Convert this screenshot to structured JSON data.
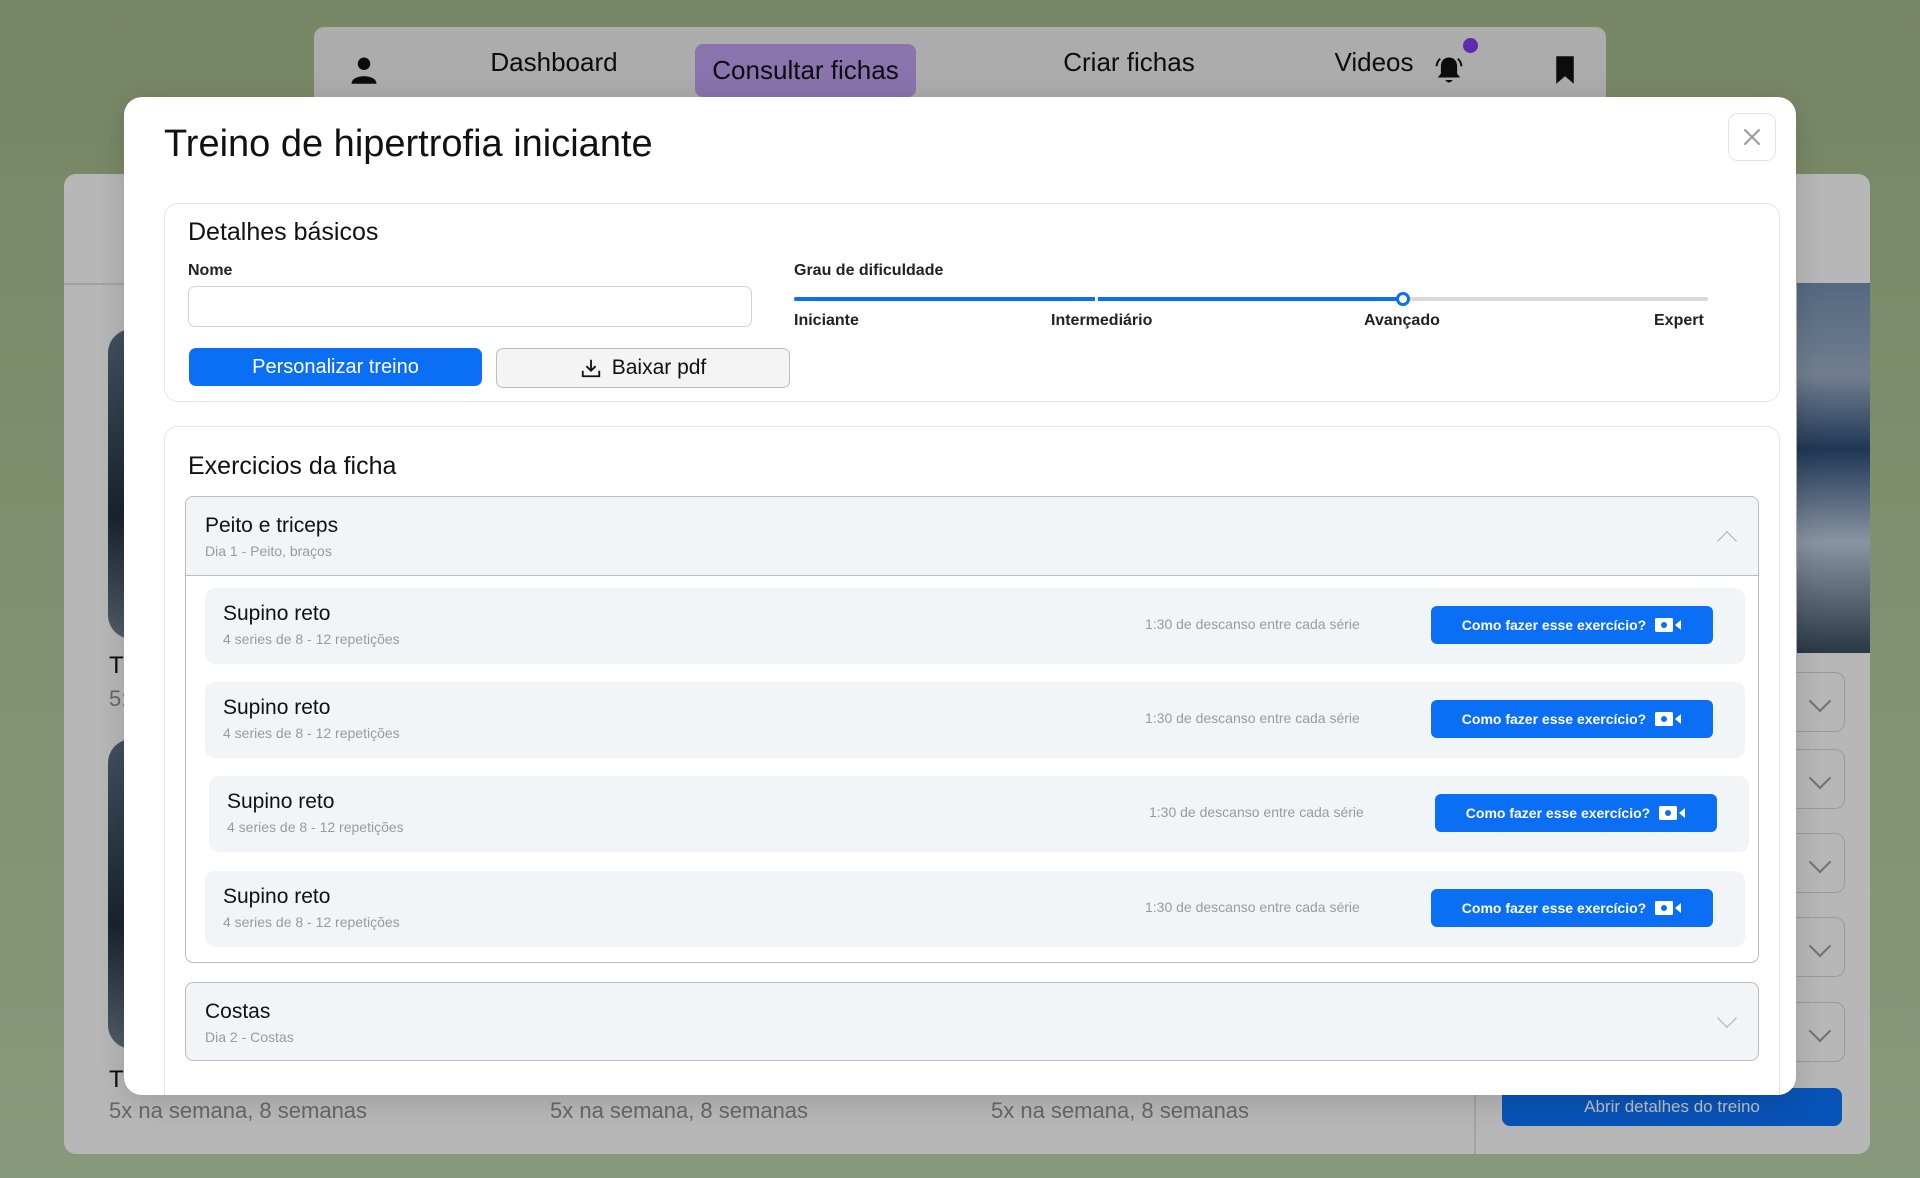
{
  "nav": {
    "items": [
      "Dashboard",
      "Consultar fichas",
      "Criar fichas",
      "Videos"
    ],
    "active": "Consultar fichas",
    "icons": [
      "user-icon",
      "bell-icon",
      "bookmark-icon"
    ],
    "badge_color": "#7c3aed"
  },
  "background": {
    "card_title_initial": "T",
    "card_meta": "5x na semana, 8 semanas",
    "card_meta_partial": "5:",
    "details_button": "Abrir detalhes do treino"
  },
  "modal": {
    "title": "Treino de hipertrofia iniciante",
    "basic": {
      "title": "Detalhes básicos",
      "name_label": "Nome",
      "name_value": "",
      "name_placeholder": "",
      "personalize_button": "Personalizar treino",
      "download_button": "Baixar pdf",
      "difficulty_label": "Grau de dificuldade",
      "levels": [
        "Iniciante",
        "Intermediário",
        "Avançado",
        "Expert"
      ],
      "selected_level": "Avançado"
    },
    "exercises": {
      "title": "Exercicios da ficha",
      "groups": [
        {
          "title": "Peito e triceps",
          "subtitle": "Dia 1 - Peito, braços",
          "expanded": true,
          "items": [
            {
              "name": "Supino reto",
              "sets": "4 series de 8 - 12 repetições",
              "rest": "1:30 de descanso entre cada série",
              "button": "Como fazer esse exercício?"
            },
            {
              "name": "Supino reto",
              "sets": "4 series de 8 - 12 repetições",
              "rest": "1:30 de descanso entre cada série",
              "button": "Como fazer esse exercício?"
            },
            {
              "name": "Supino reto",
              "sets": "4 series de 8 - 12 repetições",
              "rest": "1:30 de descanso entre cada série",
              "button": "Como fazer esse exercício?"
            },
            {
              "name": "Supino reto",
              "sets": "4 series de 8 - 12 repetições",
              "rest": "1:30 de descanso entre cada série",
              "button": "Como fazer esse exercício?"
            }
          ]
        },
        {
          "title": "Costas",
          "subtitle": "Dia 2 - Costas",
          "expanded": false,
          "items": []
        }
      ]
    }
  },
  "colors": {
    "accent": "#0b6ff5",
    "active_tab": "#b79be8"
  }
}
